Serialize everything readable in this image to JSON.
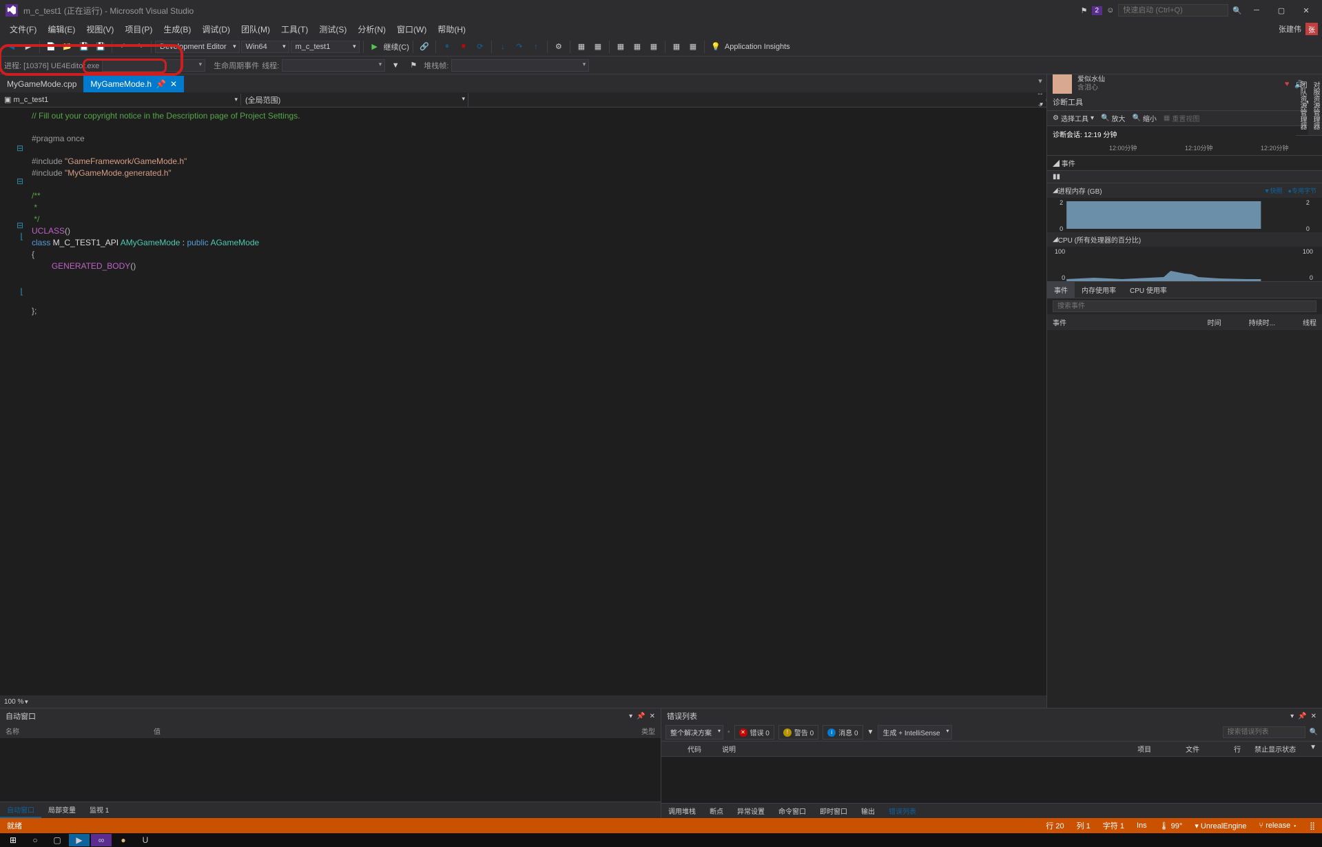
{
  "title": "m_c_test1 (正在运行) - Microsoft Visual Studio",
  "quick_launch_placeholder": "快速启动 (Ctrl+Q)",
  "notif_count": "2",
  "user_badge": "张建伟",
  "user_initial": "张",
  "menu": [
    "文件(F)",
    "编辑(E)",
    "视图(V)",
    "项目(P)",
    "生成(B)",
    "调试(D)",
    "团队(M)",
    "工具(T)",
    "测试(S)",
    "分析(N)",
    "窗口(W)",
    "帮助(H)"
  ],
  "toolbar": {
    "config": "Development Editor",
    "platform": "Win64",
    "project": "m_c_test1",
    "continue": "继续(C)",
    "insights": "Application Insights"
  },
  "toolbar2": {
    "process": "进程:  [10376] UE4Editor.exe",
    "lifecycle": "生命周期事件",
    "thread": "线程:",
    "stackframe": "堆栈帧:"
  },
  "tabs": {
    "t1": "MyGameMode.cpp",
    "t2": "MyGameMode.h"
  },
  "nav": {
    "scope": "m_c_test1",
    "member": "(全局范围)"
  },
  "code": {
    "l1": "// Fill out your copyright notice in the Description page of Project Settings.",
    "l2": "#pragma once",
    "l3a": "#include ",
    "l3b": "\"GameFramework/GameMode.h\"",
    "l4a": "#include ",
    "l4b": "\"MyGameMode.generated.h\"",
    "l5": "/**",
    "l6": " *",
    "l7": " */",
    "l8": "UCLASS",
    "l9a": "class",
    "l9b": " M_C_TEST1_API ",
    "l9c": "AMyGameMode",
    "l9d": " : ",
    "l9e": "public",
    "l9f": " AGameMode",
    "l10": "{",
    "l11": "GENERATED_BODY",
    "l12": "};"
  },
  "zoom": "100 %",
  "user_card": {
    "name": "爱似水仙",
    "sub": "含泪心"
  },
  "diag": {
    "title": "诊断工具",
    "tools": {
      "select": "选择工具",
      "zoomin": "放大",
      "zoomout": "缩小",
      "reset": "重置视图"
    },
    "session": "诊断会话: 12:19 分钟",
    "ticks": [
      "12:00分钟",
      "12:10分钟",
      "12:20分钟"
    ],
    "events": "事件",
    "mem_label": "进程内存 (GB)",
    "mem_snapshot": "快照",
    "mem_private": "专用字节",
    "cpu_label": "CPU (所有处理器的百分比)",
    "tabs": {
      "events": "事件",
      "mem": "内存使用率",
      "cpu": "CPU 使用率"
    },
    "search_placeholder": "搜索事件",
    "cols": {
      "event": "事件",
      "time": "时间",
      "duration": "持续时...",
      "thread": "线程"
    }
  },
  "chart_data": [
    {
      "type": "area",
      "title": "进程内存 (GB)",
      "ylim": [
        0,
        2
      ],
      "x_range": [
        "12:00",
        "12:20"
      ],
      "values": [
        1.9,
        1.9,
        1.9,
        1.9,
        1.9,
        1.9,
        1.9,
        1.9,
        1.9,
        1.9,
        1.9,
        1.9,
        1.9,
        1.9,
        1.9,
        1.9,
        1.9,
        1.9,
        1.9,
        1.9
      ]
    },
    {
      "type": "area",
      "title": "CPU (所有处理器的百分比)",
      "ylim": [
        0,
        100
      ],
      "x_range": [
        "12:00",
        "12:20"
      ],
      "values": [
        4,
        5,
        6,
        5,
        4,
        5,
        6,
        7,
        6,
        5,
        25,
        22,
        20,
        18,
        10,
        8,
        6,
        5,
        4,
        4
      ]
    }
  ],
  "auto": {
    "title": "自动窗口",
    "cols": {
      "name": "名称",
      "value": "值",
      "type": "类型"
    },
    "tabs": {
      "auto": "自动窗口",
      "locals": "局部变量",
      "watch": "监视 1"
    }
  },
  "err": {
    "title": "错误列表",
    "scope": "整个解决方案",
    "errors": "错误 0",
    "warnings": "警告 0",
    "messages": "消息 0",
    "source": "生成 + IntelliSense",
    "search_placeholder": "搜索错误列表",
    "cols": {
      "code": "代码",
      "desc": "说明",
      "proj": "项目",
      "file": "文件",
      "line": "行",
      "suppress": "禁止显示状态"
    },
    "bottom_tabs": [
      "调用堆栈",
      "断点",
      "异常设置",
      "命令窗口",
      "即时窗口",
      "输出",
      "错误列表"
    ]
  },
  "status": {
    "ready": "就绪",
    "line": "行 20",
    "col": "列 1",
    "char": "字符 1",
    "ins": "Ins",
    "temp": "99°",
    "engine": "UnrealEngine",
    "branch": "release"
  },
  "side_tabs": [
    "对服资源管理器",
    "团队资源管理器"
  ]
}
